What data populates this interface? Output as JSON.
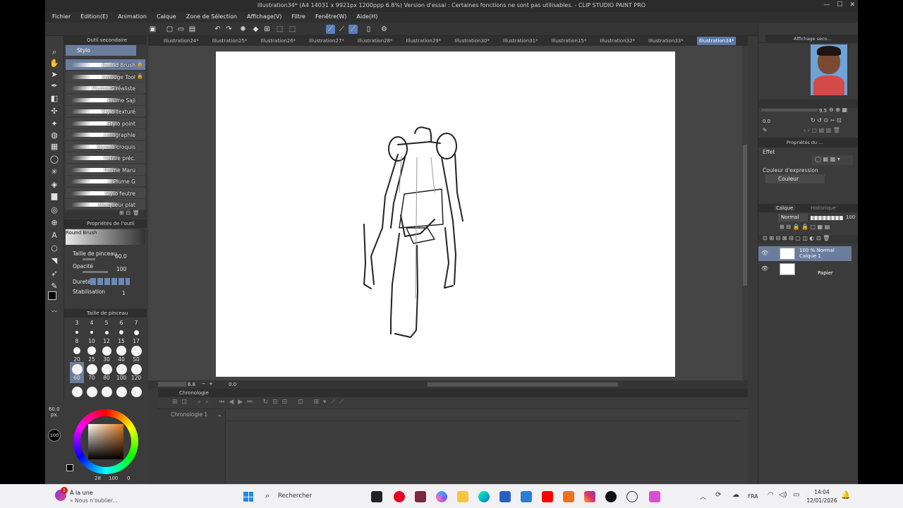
{
  "window": {
    "title": "Illustration34* (A4 14031 x 9921px 1200ppp 6.8%)  Version d'essai : Certaines fonctions ne sont pas utilisables. - CLIP STUDIO PAINT PRO"
  },
  "menu": [
    "Fichier",
    "Édition(E)",
    "Animation",
    "Calque",
    "Zone de Sélection",
    "Affichage(V)",
    "Filtre",
    "Fenêtre(W)",
    "Aide(H)"
  ],
  "subtool": {
    "header": "Outil secondaire",
    "group": "Stylo",
    "brushes": [
      {
        "label": "Round Brush",
        "locked": true,
        "selected": true
      },
      {
        "label": "Smudge Tool",
        "locked": true
      },
      {
        "label": "Plume G réaliste"
      },
      {
        "label": "Plume Saji"
      },
      {
        "label": "Stylo texturé"
      },
      {
        "label": "Stylo point"
      },
      {
        "label": "Calligraphie"
      },
      {
        "label": "Stylo à croquis"
      },
      {
        "label": "Feutre préc."
      },
      {
        "label": "Plume Maru"
      },
      {
        "label": "Plume G"
      },
      {
        "label": "Stylo feutre"
      },
      {
        "label": "Marqueur plat"
      }
    ]
  },
  "tool_properties": {
    "header": "Propriétés de l'outil",
    "brush_name": "Round Brush",
    "size_label": "Taille de pinceau",
    "size_value": "60.0",
    "opacity_label": "Opacité",
    "opacity_value": "100",
    "hardness_label": "Dureté",
    "stabilization_label": "Stabilisation",
    "stabilization_value": "1"
  },
  "brush_size": {
    "header": "Taille de pinceau",
    "top_labels": [
      "3",
      "4",
      "5",
      "6",
      "7"
    ],
    "rows": [
      [
        "8",
        "10",
        "12",
        "15",
        "17"
      ],
      [
        "20",
        "25",
        "30",
        "40",
        "50"
      ],
      [
        "60",
        "70",
        "80",
        "100",
        "120"
      ]
    ],
    "selected": "60"
  },
  "color": {
    "size_readout": "60.0",
    "size_unit": "px",
    "opacity_readout": "100",
    "bottom_values": [
      "28",
      "100",
      "0"
    ],
    "main_color": "#000000",
    "sub_color": "#ffffff"
  },
  "tabs": [
    "Illustration24*",
    "Illustration25*",
    "Illustration26*",
    "Illustration27*",
    "Illustration28*",
    "Illustration29*",
    "Illustration30*",
    "Illustration31*",
    "Illustration15*",
    "Illustration32*",
    "Illustration33*",
    "Illustration34*"
  ],
  "active_tab": "Illustration34*",
  "navigator": {
    "zoom": "6.8",
    "rotation": "0.0"
  },
  "timeline": {
    "header": "Chronologie",
    "dropdown": "Chronologie 1"
  },
  "right": {
    "sub_view_header": "Affichage seco...",
    "zoom_value": "9.5",
    "rotation_value": "0.0",
    "layer_prop_header": "Propriétés du ...",
    "effect_label": "Effet",
    "expression_label": "Couleur d'expression",
    "expression_value": "Couleur",
    "layers_tab": "Calque",
    "history_tab": "Historique",
    "blend_mode": "Normal",
    "opacity": "100",
    "layers": [
      {
        "line1": "100 % Normal",
        "line2": "Calque 1",
        "selected": true
      },
      {
        "line1": "",
        "line2": "Papier",
        "selected": false
      }
    ]
  },
  "taskbar": {
    "notif_title": "À la une",
    "notif_sub": "« Nous n'oublier...",
    "notif_badge": "1",
    "search_placeholder": "Rechercher",
    "lang": "FRA",
    "time": "14:04",
    "date": "12/01/2026"
  }
}
